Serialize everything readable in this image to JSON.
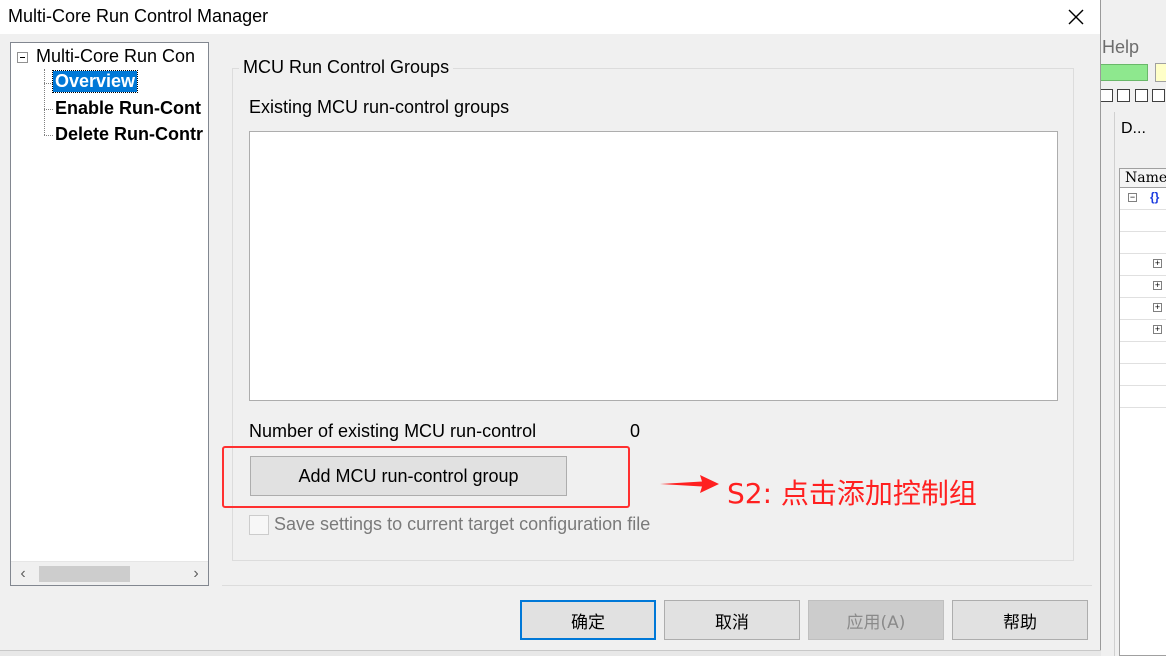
{
  "dialog": {
    "title": "Multi-Core Run Control Manager"
  },
  "tree": {
    "root": "Multi-Core Run Con",
    "items": [
      "Overview",
      "Enable Run-Cont",
      "Delete Run-Contr"
    ]
  },
  "main": {
    "groupbox_title": "MCU Run Control Groups",
    "list_label": "Existing MCU run-control groups",
    "groups": [],
    "count_label": "Number of existing MCU run-control",
    "count_value": "0",
    "add_button": "Add MCU run-control group",
    "save_checkbox_label": "Save settings to current target configuration file",
    "save_checked": false
  },
  "annotation": {
    "text": "S2: 点击添加控制组",
    "color": "#ff2020"
  },
  "footer": {
    "ok": "确定",
    "cancel": "取消",
    "apply": "应用(A)",
    "help": "帮助"
  },
  "background_app": {
    "menu_help": "Help",
    "panel_title": "D...",
    "list_header": "Name"
  },
  "colors": {
    "selection": "#0078d7",
    "annotation": "#ff2020"
  }
}
